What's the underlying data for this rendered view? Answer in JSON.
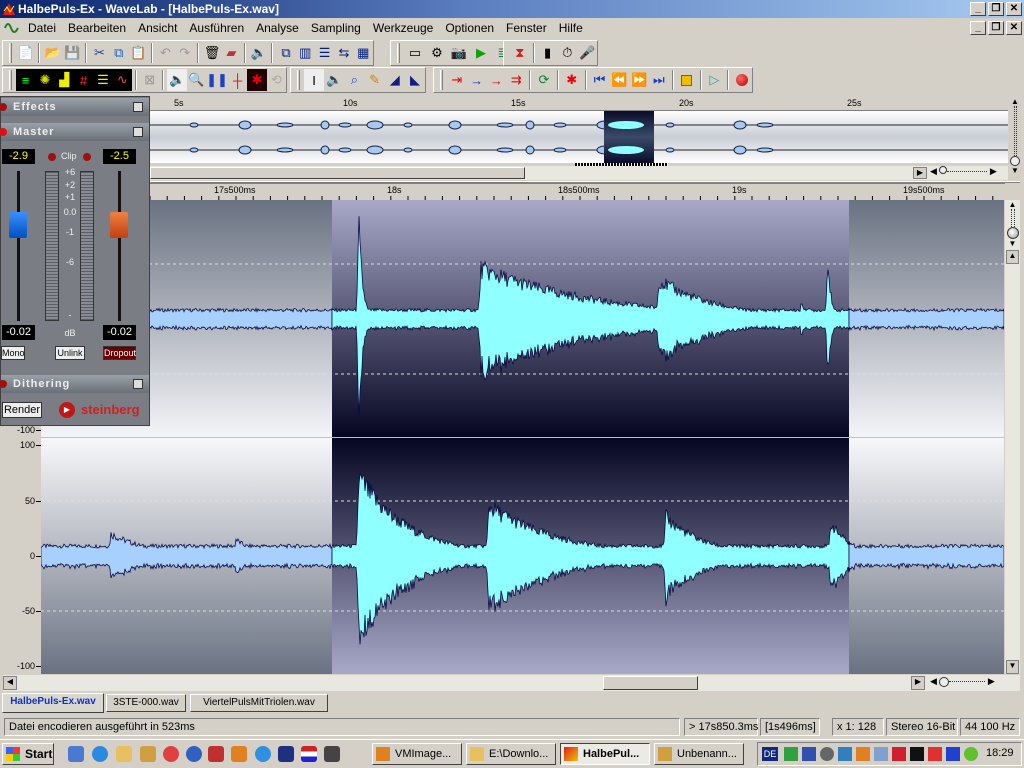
{
  "window": {
    "title": "HalbePuls-Ex - WaveLab - [HalbePuls-Ex.wav]",
    "app_icon": "wavelab-icon",
    "controls": [
      "minimize",
      "restore",
      "close"
    ]
  },
  "menubar": {
    "items": [
      "Datei",
      "Bearbeiten",
      "Ansicht",
      "Ausführen",
      "Analyse",
      "Sampling",
      "Werkzeuge",
      "Optionen",
      "Fenster",
      "Hilfe"
    ]
  },
  "toolbar1": {
    "icons": [
      "new-file-icon",
      "open-folder-icon",
      "save-icon",
      "cut-icon",
      "copy-icon",
      "paste-icon",
      "undo-icon",
      "redo-icon",
      "trash-icon",
      "eraser-icon",
      "speaker-icon",
      "cascade-windows-icon",
      "tile-vertical-icon",
      "tile-horizontal-icon",
      "arrange-icon",
      "keyboard-layout-icon",
      "level-meter-icon",
      "spectrum-icon",
      "snapshot-icon",
      "play-green-icon",
      "wave-edit-icon",
      "marker-icon",
      "fader-icon",
      "timer-icon",
      "microphone-icon"
    ]
  },
  "toolbar2": {
    "icons": [
      "vu-meter-icon",
      "spectroscope-icon",
      "spectrum-analyzer-icon",
      "oscilloscope-icon",
      "bit-meter-icon",
      "phasescope-icon",
      "dialog-icon",
      "speaker-play-icon",
      "magnify-icon",
      "pause-icon",
      "marker-red-icon",
      "waveform-red-icon",
      "loop-disabled-icon",
      "text-cursor-icon",
      "speaker-tool-icon",
      "zoom-tool-icon",
      "pencil-icon",
      "play-left-icon",
      "play-right-icon",
      "marker-insert-icon",
      "marker-prev-icon",
      "marker-next-icon",
      "marker-multi-icon",
      "loop-icon",
      "cut-silence-icon",
      "go-start-icon",
      "rewind-icon",
      "fast-forward-icon",
      "go-end-icon",
      "stop-icon",
      "play-icon",
      "record-icon"
    ]
  },
  "overview": {
    "ruler_labels": [
      "5s",
      "10s",
      "15s",
      "20s",
      "25s"
    ]
  },
  "main_ruler": {
    "labels": [
      "17s500ms",
      "18s",
      "18s500ms",
      "19s",
      "19s500ms"
    ]
  },
  "y_axis": {
    "top_channel_bottom_label": "-100",
    "labels": [
      "100",
      "50",
      "0",
      "-50",
      "-100"
    ]
  },
  "master_panel": {
    "effects_label": "Effects",
    "master_label": "Master",
    "left_peak": "-2.9",
    "right_peak": "-2.5",
    "clip_label": "Clip",
    "scale": [
      "+6",
      "+2",
      "+1",
      "0.0",
      "-1",
      "-6",
      "-"
    ],
    "left_volume": "-0.02",
    "right_volume": "-0.02",
    "db_label": "dB",
    "mono_button": "Mono",
    "unlink_button": "Unlink",
    "dropout_button": "Dropout",
    "dithering_label": "Dithering",
    "render_button": "Render",
    "brand": "steinberg"
  },
  "file_tabs": [
    {
      "label": "HalbePuls-Ex.wav",
      "active": true
    },
    {
      "label": "3STE-000.wav",
      "active": false
    },
    {
      "label": "ViertelPulsMitTriolen.wav",
      "active": false
    }
  ],
  "statusbar": {
    "message": "Datei encodieren ausgeführt in 523ms",
    "cursor_position": "> 17s850.3ms",
    "selection_length": "[1s496ms]",
    "zoom": "x 1: 128",
    "format": "Stereo 16-Bit",
    "sample_rate": "44 100 Hz"
  },
  "taskbar": {
    "start_label": "Start",
    "quicklaunch": [
      "outlook-icon",
      "ie-icon",
      "folder-icon",
      "home-icon",
      "media-icon",
      "player-icon",
      "tool-icon",
      "vmware-icon",
      "quicktime-icon",
      "diff3-icon",
      "flag-icon",
      "alien-icon"
    ],
    "tasks": [
      {
        "label": "VMImage...",
        "active": false
      },
      {
        "label": "E:\\Downlo...",
        "active": false
      },
      {
        "label": "HalbePul...",
        "active": true
      },
      {
        "label": "Unbenann...",
        "active": false
      }
    ],
    "language": "DE",
    "clock": "18:29"
  },
  "colors": {
    "wave_fill_selected": "#90ffff",
    "wave_fill": "#a8d0ff",
    "wave_outline": "#0a0a40",
    "selection_dark": "#050622",
    "selection_light": "#a8a8c8"
  }
}
